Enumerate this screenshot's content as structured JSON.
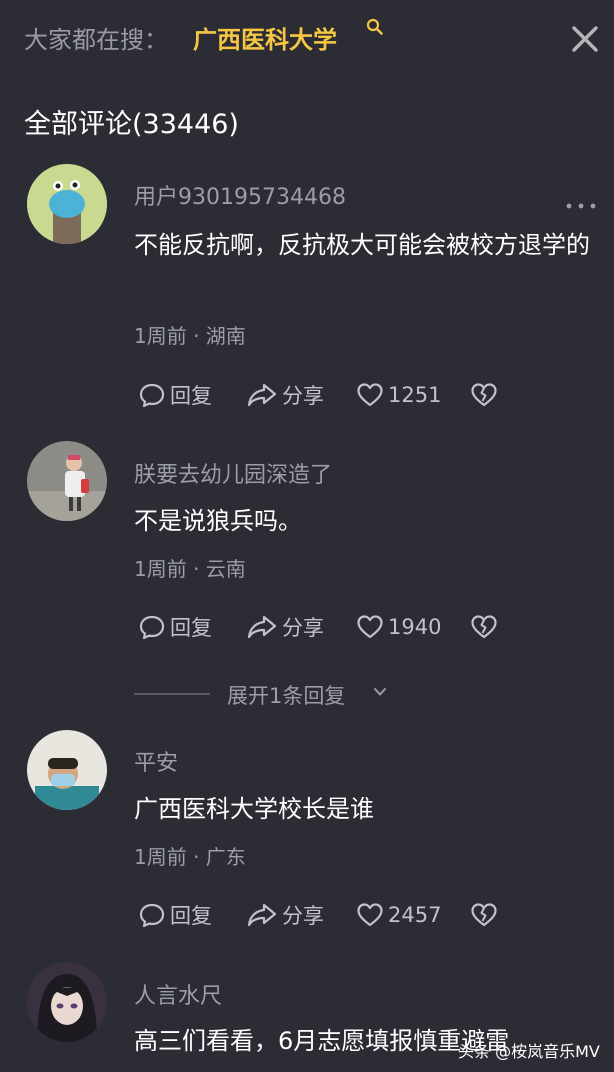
{
  "search": {
    "prefix": "大家都在搜：",
    "term": "广西医科大学",
    "search_icon": "search-icon",
    "close_icon": "close-icon"
  },
  "section": {
    "title": "全部评论(33446)"
  },
  "comments": [
    {
      "user": "用户930195734468",
      "text": "不能反抗啊，反抗极大可能会被校方退学的",
      "meta": "1周前 · 湖南",
      "reply_label": "回复",
      "share_label": "分享",
      "likes": "1251"
    },
    {
      "user": "朕要去幼儿园深造了",
      "text": "不是说狼兵吗。",
      "meta": "1周前 · 云南",
      "reply_label": "回复",
      "share_label": "分享",
      "likes": "1940"
    },
    {
      "user": "平安",
      "text": "广西医科大学校长是谁",
      "meta": "1周前 · 广东",
      "reply_label": "回复",
      "share_label": "分享",
      "likes": "2457"
    },
    {
      "user": "人言水尺",
      "text": "高三们看看，6月志愿填报慎重避雷"
    }
  ],
  "expand_replies": "展开1条回复",
  "watermark": "头条 @桉岚音乐MV",
  "colors": {
    "background": "#2b2c34",
    "search_term": "#f7c744",
    "muted_text": "#9c9da5",
    "action_text": "#c2c3c9"
  }
}
